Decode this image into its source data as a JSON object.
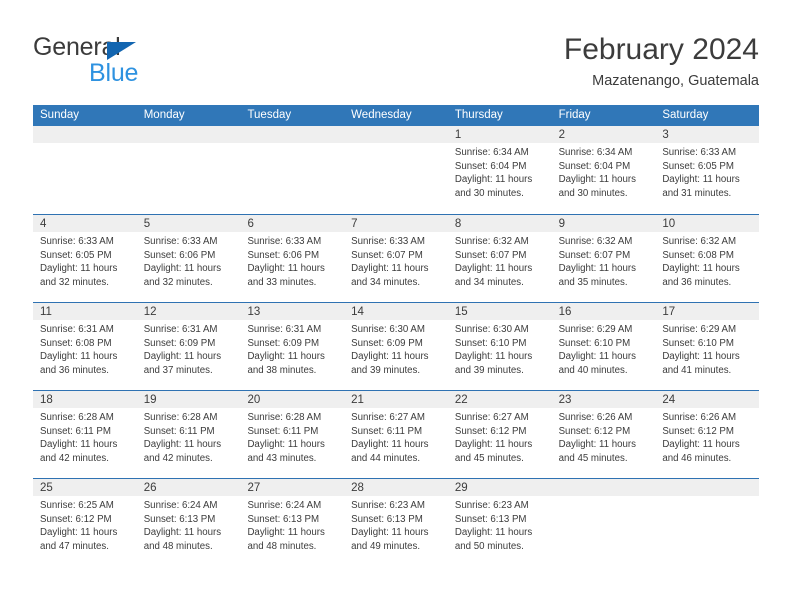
{
  "brand": {
    "name_part1": "General",
    "name_part2": "Blue",
    "triangle_color": "#1265b0",
    "blue_color": "#2e92e0"
  },
  "header": {
    "month_title": "February 2024",
    "location": "Mazatenango, Guatemala",
    "header_bg": "#3077b8",
    "row_divider": "#2f72b2",
    "daynum_band_bg": "#efefef"
  },
  "weekdays": [
    "Sunday",
    "Monday",
    "Tuesday",
    "Wednesday",
    "Thursday",
    "Friday",
    "Saturday"
  ],
  "weeks": [
    [
      {
        "day": "",
        "lines": []
      },
      {
        "day": "",
        "lines": []
      },
      {
        "day": "",
        "lines": []
      },
      {
        "day": "",
        "lines": []
      },
      {
        "day": "1",
        "lines": [
          "Sunrise: 6:34 AM",
          "Sunset: 6:04 PM",
          "Daylight: 11 hours",
          "and 30 minutes."
        ]
      },
      {
        "day": "2",
        "lines": [
          "Sunrise: 6:34 AM",
          "Sunset: 6:04 PM",
          "Daylight: 11 hours",
          "and 30 minutes."
        ]
      },
      {
        "day": "3",
        "lines": [
          "Sunrise: 6:33 AM",
          "Sunset: 6:05 PM",
          "Daylight: 11 hours",
          "and 31 minutes."
        ]
      }
    ],
    [
      {
        "day": "4",
        "lines": [
          "Sunrise: 6:33 AM",
          "Sunset: 6:05 PM",
          "Daylight: 11 hours",
          "and 32 minutes."
        ]
      },
      {
        "day": "5",
        "lines": [
          "Sunrise: 6:33 AM",
          "Sunset: 6:06 PM",
          "Daylight: 11 hours",
          "and 32 minutes."
        ]
      },
      {
        "day": "6",
        "lines": [
          "Sunrise: 6:33 AM",
          "Sunset: 6:06 PM",
          "Daylight: 11 hours",
          "and 33 minutes."
        ]
      },
      {
        "day": "7",
        "lines": [
          "Sunrise: 6:33 AM",
          "Sunset: 6:07 PM",
          "Daylight: 11 hours",
          "and 34 minutes."
        ]
      },
      {
        "day": "8",
        "lines": [
          "Sunrise: 6:32 AM",
          "Sunset: 6:07 PM",
          "Daylight: 11 hours",
          "and 34 minutes."
        ]
      },
      {
        "day": "9",
        "lines": [
          "Sunrise: 6:32 AM",
          "Sunset: 6:07 PM",
          "Daylight: 11 hours",
          "and 35 minutes."
        ]
      },
      {
        "day": "10",
        "lines": [
          "Sunrise: 6:32 AM",
          "Sunset: 6:08 PM",
          "Daylight: 11 hours",
          "and 36 minutes."
        ]
      }
    ],
    [
      {
        "day": "11",
        "lines": [
          "Sunrise: 6:31 AM",
          "Sunset: 6:08 PM",
          "Daylight: 11 hours",
          "and 36 minutes."
        ]
      },
      {
        "day": "12",
        "lines": [
          "Sunrise: 6:31 AM",
          "Sunset: 6:09 PM",
          "Daylight: 11 hours",
          "and 37 minutes."
        ]
      },
      {
        "day": "13",
        "lines": [
          "Sunrise: 6:31 AM",
          "Sunset: 6:09 PM",
          "Daylight: 11 hours",
          "and 38 minutes."
        ]
      },
      {
        "day": "14",
        "lines": [
          "Sunrise: 6:30 AM",
          "Sunset: 6:09 PM",
          "Daylight: 11 hours",
          "and 39 minutes."
        ]
      },
      {
        "day": "15",
        "lines": [
          "Sunrise: 6:30 AM",
          "Sunset: 6:10 PM",
          "Daylight: 11 hours",
          "and 39 minutes."
        ]
      },
      {
        "day": "16",
        "lines": [
          "Sunrise: 6:29 AM",
          "Sunset: 6:10 PM",
          "Daylight: 11 hours",
          "and 40 minutes."
        ]
      },
      {
        "day": "17",
        "lines": [
          "Sunrise: 6:29 AM",
          "Sunset: 6:10 PM",
          "Daylight: 11 hours",
          "and 41 minutes."
        ]
      }
    ],
    [
      {
        "day": "18",
        "lines": [
          "Sunrise: 6:28 AM",
          "Sunset: 6:11 PM",
          "Daylight: 11 hours",
          "and 42 minutes."
        ]
      },
      {
        "day": "19",
        "lines": [
          "Sunrise: 6:28 AM",
          "Sunset: 6:11 PM",
          "Daylight: 11 hours",
          "and 42 minutes."
        ]
      },
      {
        "day": "20",
        "lines": [
          "Sunrise: 6:28 AM",
          "Sunset: 6:11 PM",
          "Daylight: 11 hours",
          "and 43 minutes."
        ]
      },
      {
        "day": "21",
        "lines": [
          "Sunrise: 6:27 AM",
          "Sunset: 6:11 PM",
          "Daylight: 11 hours",
          "and 44 minutes."
        ]
      },
      {
        "day": "22",
        "lines": [
          "Sunrise: 6:27 AM",
          "Sunset: 6:12 PM",
          "Daylight: 11 hours",
          "and 45 minutes."
        ]
      },
      {
        "day": "23",
        "lines": [
          "Sunrise: 6:26 AM",
          "Sunset: 6:12 PM",
          "Daylight: 11 hours",
          "and 45 minutes."
        ]
      },
      {
        "day": "24",
        "lines": [
          "Sunrise: 6:26 AM",
          "Sunset: 6:12 PM",
          "Daylight: 11 hours",
          "and 46 minutes."
        ]
      }
    ],
    [
      {
        "day": "25",
        "lines": [
          "Sunrise: 6:25 AM",
          "Sunset: 6:12 PM",
          "Daylight: 11 hours",
          "and 47 minutes."
        ]
      },
      {
        "day": "26",
        "lines": [
          "Sunrise: 6:24 AM",
          "Sunset: 6:13 PM",
          "Daylight: 11 hours",
          "and 48 minutes."
        ]
      },
      {
        "day": "27",
        "lines": [
          "Sunrise: 6:24 AM",
          "Sunset: 6:13 PM",
          "Daylight: 11 hours",
          "and 48 minutes."
        ]
      },
      {
        "day": "28",
        "lines": [
          "Sunrise: 6:23 AM",
          "Sunset: 6:13 PM",
          "Daylight: 11 hours",
          "and 49 minutes."
        ]
      },
      {
        "day": "29",
        "lines": [
          "Sunrise: 6:23 AM",
          "Sunset: 6:13 PM",
          "Daylight: 11 hours",
          "and 50 minutes."
        ]
      },
      {
        "day": "",
        "lines": []
      },
      {
        "day": "",
        "lines": []
      }
    ]
  ]
}
